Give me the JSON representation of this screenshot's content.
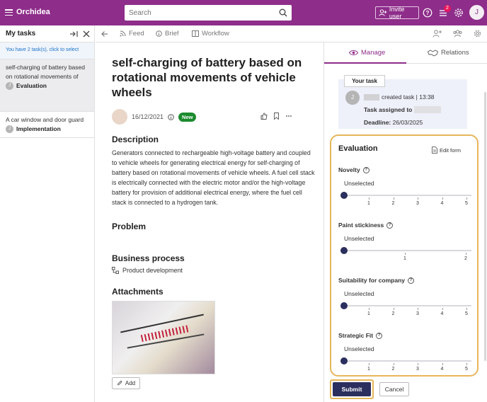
{
  "app": {
    "name": "Orchidea"
  },
  "header": {
    "search_placeholder": "Search",
    "invite_label": "Invite user",
    "notification_count": "2",
    "avatar_initial": "J"
  },
  "left": {
    "title": "My tasks",
    "info": "You have 2 task(s), click to select",
    "tasks": [
      {
        "title": "self-charging of battery based on rotational movements of",
        "initial": "J",
        "stage": "Evaluation"
      },
      {
        "title": "A car window and door guard",
        "initial": "J",
        "stage": "Implementation"
      }
    ]
  },
  "mid": {
    "tabs": [
      "Feed",
      "Brief",
      "Workflow"
    ],
    "title": "self-charging of battery based on rotational movements of vehicle wheels",
    "date": "16/12/2021",
    "badge": "New",
    "description_heading": "Description",
    "description": "Generators connected to rechargeable high-voltage battery and coupled to vehicle wheels for generating electrical energy for self-charging of battery based on rotational movements of vehicle wheels. A fuel cell stack is electrically connected with the electric motor and/or the high-voltage battery for provision of additional electrical energy, where the fuel cell stack is connected to a hydrogen tank.",
    "problem_heading": "Problem",
    "business_heading": "Business process",
    "business_value": "Product development",
    "attachments_heading": "Attachments",
    "add_label": "Add"
  },
  "right": {
    "tabs": [
      "Manage",
      "Relations"
    ],
    "your_task": "Your task",
    "task_initial": "J",
    "created": "created task | 13:38",
    "assigned": "Task assigned to",
    "deadline_label": "Deadline:",
    "deadline_value": "26/03/2025",
    "evaluation_title": "Evaluation",
    "edit_form": "Edit form",
    "criteria": [
      {
        "name": "Novelty",
        "value": "Unselected",
        "ticks": [
          "1",
          "2",
          "3",
          "4",
          "5"
        ]
      },
      {
        "name": "Paint stickiness",
        "value": "Unselected",
        "ticks": [
          "1",
          "2"
        ]
      },
      {
        "name": "Suitability for company",
        "value": "Unselected",
        "ticks": [
          "1",
          "2",
          "3",
          "4",
          "5"
        ]
      },
      {
        "name": "Strategic Fit",
        "value": "Unselected",
        "ticks": [
          "1",
          "2",
          "3",
          "4",
          "5"
        ]
      }
    ],
    "submit": "Submit",
    "cancel": "Cancel"
  },
  "colors": {
    "brand": "#8e2d8a",
    "accent_dark": "#2b2f5e",
    "highlight": "#e6b65a",
    "new_badge": "#1b8b2e"
  }
}
